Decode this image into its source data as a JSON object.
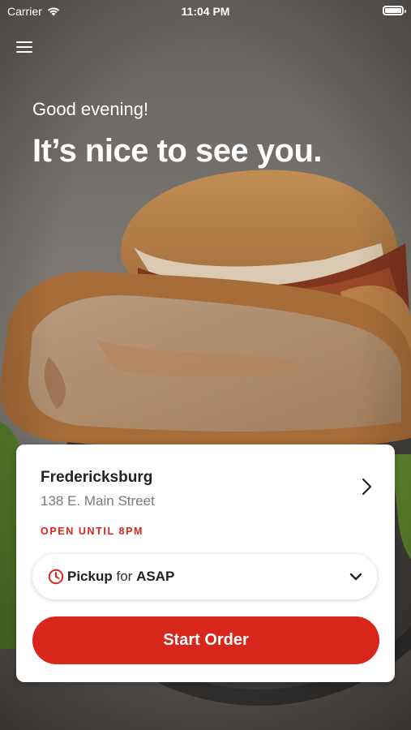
{
  "status_bar": {
    "carrier": "Carrier",
    "time": "11:04 PM"
  },
  "hero": {
    "greeting": "Good evening!",
    "headline": "It’s nice to see you."
  },
  "location": {
    "name": "Fredericksburg",
    "address": "138 E. Main Street",
    "hours": "OPEN UNTIL 8PM"
  },
  "order_mode": {
    "method": "Pickup",
    "connector": "for",
    "time": "ASAP"
  },
  "cta": {
    "label": "Start Order"
  },
  "colors": {
    "accent": "#d9261c"
  },
  "icons": [
    "menu-icon",
    "wifi-icon",
    "battery-icon",
    "chevron-right-icon",
    "clock-icon",
    "chevron-down-icon"
  ]
}
